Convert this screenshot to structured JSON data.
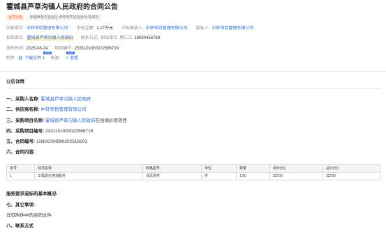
{
  "page": {
    "title": "霍城县芦草沟镇人民政府的合同公告",
    "status_badge": "合同公告",
    "region": "新疆维吾尔自治区-伊犁哈萨克自治州-霍城县"
  },
  "meta": {
    "winner_label": "中标单位:",
    "winner_value": "中轩项目管理有限公司",
    "amount_label": "中标金额:",
    "amount_value": "2.27万元",
    "candidate_label": "中标候选人:",
    "candidate_value": "中轩项目管理有限公司",
    "bidder_label": "投标人:",
    "bidder_value": "中轩项目管理有限公司",
    "tenderer_label": "招采单位:",
    "tenderer_value": "霍城县芦草沟镇人民政府",
    "contact_method_label": "联系方式:",
    "contact_method_value": "招采单位",
    "contact_person": "杨仁江",
    "contact_phone": "18590456788",
    "publish_time_label": "发布时间:",
    "publish_time_value": "2025-08-24",
    "project_no_label": "项目编号:",
    "project_no_value": "2331101000022586719",
    "attachment_label": "附件:",
    "attachment_value": "下载文件 1",
    "source_label": "来源:",
    "source_value": "查看",
    "svip_chip_1": "SVIP",
    "svip_chip_2": "SVIP"
  },
  "details": {
    "section_title": "公告详情",
    "purchaser_key": "一、采购人名称:",
    "purchaser_value": "霍城县芦草沟镇人民政府",
    "supplier_key": "二、供应商名称:",
    "supplier_value": "中轩项目管理有限公司",
    "project_name_key": "三、采购项目名称:",
    "project_name_link": "霍城县芦草沟镇人民政府",
    "project_name_suffix": "在线询价馆项目",
    "project_no_key": "四、采购项目编号:",
    "project_no_value": "2331101000022586719",
    "contract_no_key": "五、合同编号:",
    "contract_no_value": "11N01034580202518203",
    "contract_content_key": "六、合同内容:",
    "requirements_key": "服务要求或标的基本概况:",
    "other_key": "七、其它事项:",
    "other_value": "详见附件中的合同文件",
    "contact_key": "八、联系方式"
  },
  "table": {
    "headers": [
      "序号",
      "标项名称",
      "规格型号",
      "单位",
      "数量",
      "单价(元)",
      "总价(元)"
    ],
    "rows": [
      [
        "1",
        "工程造价咨询服务",
        "详见附件",
        "件",
        "1.00",
        "22700",
        "22700"
      ]
    ]
  }
}
